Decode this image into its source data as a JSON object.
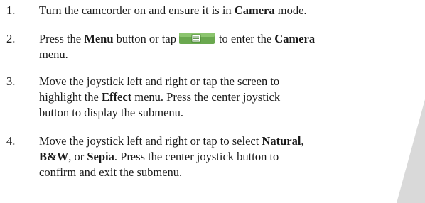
{
  "steps": [
    {
      "number": "1.",
      "lines": [
        [
          "Turn the camcorder on and ensure it is in ",
          "Camera",
          " mode."
        ]
      ]
    },
    {
      "number": "2.",
      "line1_a": "Press the ",
      "line1_b": "Menu",
      "line1_c": " button or tap",
      "line1_d": "to enter the ",
      "line1_e": "Camera",
      "line2": "menu.",
      "icon": "menu-list-icon"
    },
    {
      "number": "3.",
      "line1": "Move the joystick left and right or tap the screen to",
      "line2_a": "highlight the ",
      "line2_b": "Effect",
      "line2_c": " menu. Press the center joystick",
      "line3": "button to display the submenu."
    },
    {
      "number": "4.",
      "line1_a": "Move the joystick left and right or tap to select ",
      "line1_b": "Natural",
      "line1_c": ",",
      "line2_a": "B&W",
      "line2_b": ", or ",
      "line2_c": "Sepia",
      "line2_d": ". Press the center joystick button to",
      "line3": "confirm and exit the submenu."
    }
  ],
  "colors": {
    "text": "#1a1a1a",
    "corner_shape": "#d9d9d9",
    "icon_fill": "#6aa84f",
    "icon_dark": "#3d7a2a"
  }
}
